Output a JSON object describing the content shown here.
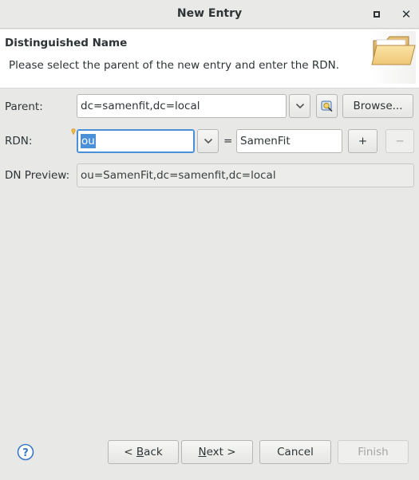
{
  "window": {
    "title": "New Entry",
    "maximize_icon": "maximize-icon",
    "close_icon": "close-icon",
    "close_glyph": "✕"
  },
  "header": {
    "title": "Distinguished Name",
    "description": "Please select the parent of the new entry and enter the RDN.",
    "icon": "folder-icon"
  },
  "form": {
    "parent": {
      "label": "Parent:",
      "value": "dc=samenfit,dc=local",
      "dropdown_icon": "chevron-down-icon",
      "browse_icon": "ldap-browse-icon",
      "browse_label": "Browse..."
    },
    "rdn": {
      "label": "RDN:",
      "type_value": "ou",
      "equals": "=",
      "value": "SamenFit",
      "add_label": "+",
      "remove_label": "−"
    },
    "dn_preview": {
      "label": "DN Preview:",
      "value": "ou=SamenFit,dc=samenfit,dc=local"
    }
  },
  "footer": {
    "help_icon": "help-icon",
    "back_prefix": "< ",
    "back_accel": "B",
    "back_rest": "ack",
    "next_accel": "N",
    "next_rest": "ext >",
    "cancel_label": "Cancel",
    "finish_label": "Finish"
  },
  "colors": {
    "accent": "#4a90d9",
    "window_bg": "#e8e8e7",
    "header_bg": "#ffffff",
    "disabled_text": "#a5a7a6"
  }
}
